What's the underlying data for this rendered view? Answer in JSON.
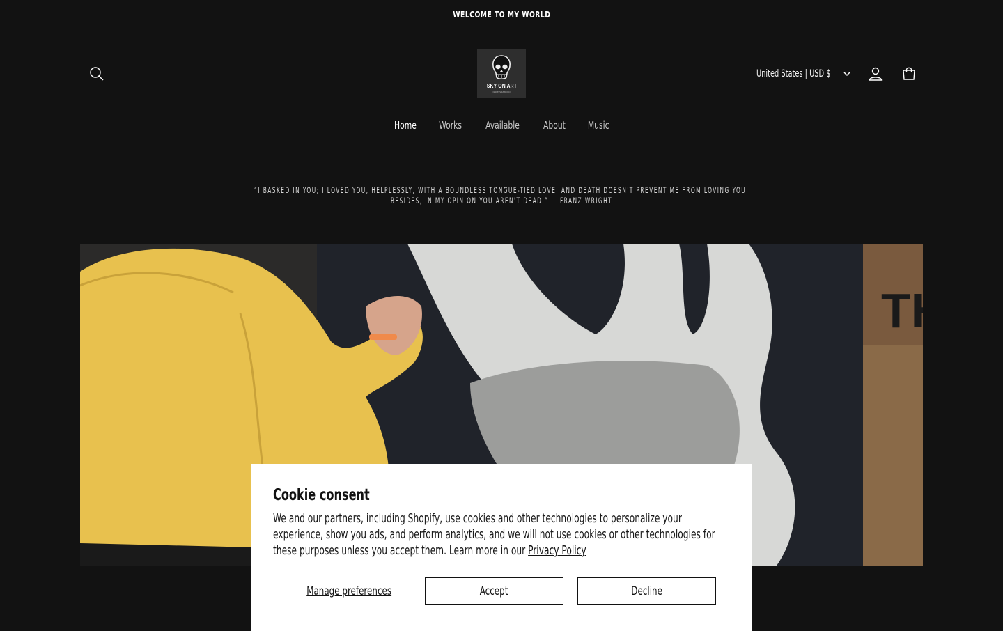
{
  "announcement": {
    "text": "WELCOME TO MY WORLD"
  },
  "header": {
    "logo_text": "SKY ON ART",
    "logo_sub": "gallery&studio",
    "localization": "United States | USD $",
    "icons": {
      "search": "search-icon",
      "account": "account-icon",
      "cart": "cart-icon",
      "chevron": "chevron-down-icon"
    }
  },
  "nav": {
    "items": [
      {
        "label": "Home",
        "active": true
      },
      {
        "label": "Works",
        "active": false
      },
      {
        "label": "Available",
        "active": false
      },
      {
        "label": "About",
        "active": false
      },
      {
        "label": "Music",
        "active": false
      }
    ]
  },
  "quote": {
    "line1": "“I BASKED IN YOU; I LOVED YOU, HELPLESSLY, WITH A BOUNDLESS TONGUE-TIED LOVE. AND DEATH DOESN'T PREVENT ME FROM LOVING YOU.",
    "line2": "BESIDES, IN MY OPINION YOU AREN'T DEAD.” — FRANZ WRIGHT"
  },
  "cookie": {
    "title": "Cookie consent",
    "body": "We and our partners, including Shopify, use cookies and other technologies to personalize your experience, show you ads, and perform analytics, and we will not use cookies or other technologies for these purposes unless you accept them. Learn more in our ",
    "link": "Privacy Policy",
    "manage": "Manage preferences",
    "accept": "Accept",
    "decline": "Decline"
  },
  "colors": {
    "background": "#121212",
    "text": "#ffffff",
    "dialog": "#ffffff",
    "hero_sweater": "#e8c14e"
  }
}
